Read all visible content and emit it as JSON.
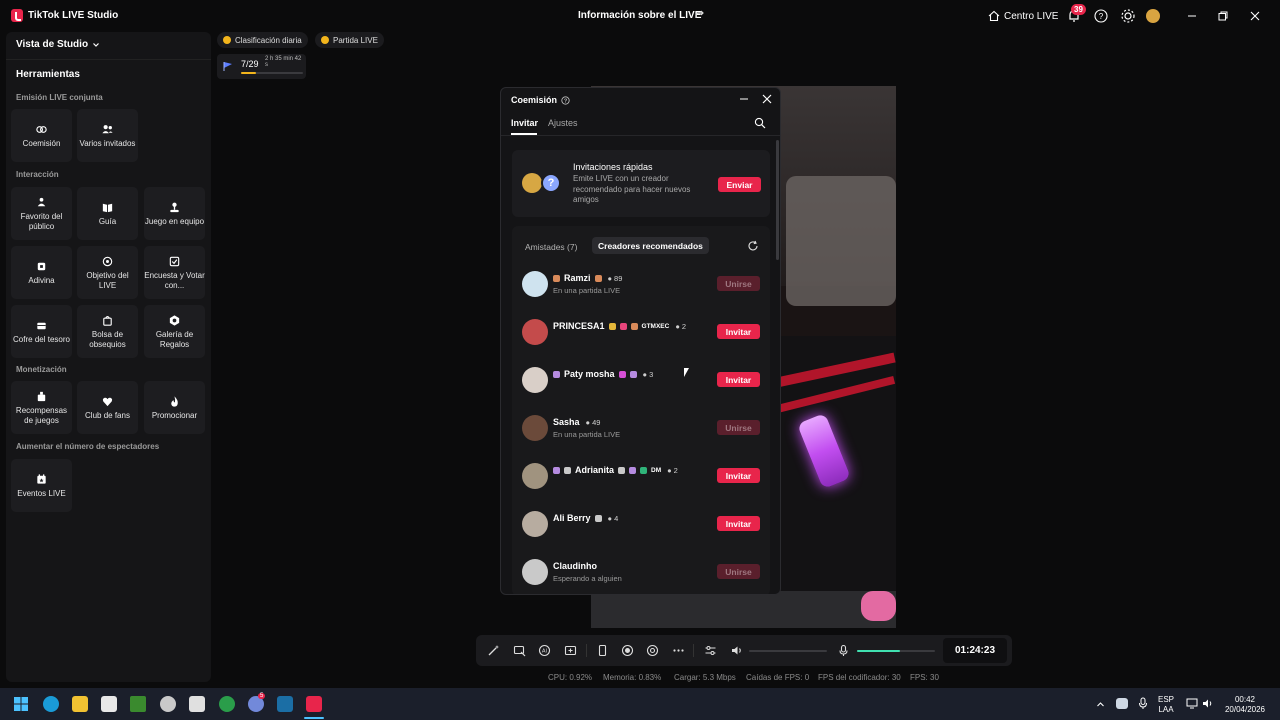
{
  "app": {
    "name": "TikTok LIVE Studio",
    "center_title": "Información sobre el LIVE",
    "centro_label": "Centro LIVE",
    "notifications": "39"
  },
  "sidebar": {
    "view_label": "Vista de Studio",
    "tools_title": "Herramientas",
    "sections": {
      "joint": "Emisión LIVE conjunta",
      "interaction": "Interacción",
      "monetization": "Monetización",
      "viewers": "Aumentar el número de espectadores"
    },
    "tools": {
      "coemision": "Coemisión",
      "varios": "Varios invitados",
      "favorito": "Favorito del público",
      "guia": "Guía",
      "juego_equipo": "Juego en equipo",
      "adivina": "Adivina",
      "objetivo": "Objetivo del LIVE",
      "encuesta": "Encuesta y Votar con...",
      "cofre": "Cofre del tesoro",
      "bolsa": "Bolsa de obsequios",
      "galeria": "Galería de Regalos",
      "recompensas": "Recompensas de juegos",
      "club": "Club de fans",
      "promocionar": "Promocionar",
      "eventos": "Eventos LIVE"
    }
  },
  "chips": {
    "ranking": "Clasificación diaria",
    "match": "Partida LIVE"
  },
  "progress": {
    "count": "7/29",
    "time": "2 h 35 min 42 s",
    "fraction": 0.24
  },
  "modal": {
    "title": "Coemisión",
    "tab_invite": "Invitar",
    "tab_settings": "Ajustes",
    "quick_title": "Invitaciones rápidas",
    "quick_desc": "Emite LIVE con un creador recomendado para hacer nuevos amigos",
    "send_label": "Enviar",
    "list_tab_friends": "Amistades (7)",
    "list_tab_recommended": "Creadores recomendados",
    "rows": [
      {
        "name": "Ramzi",
        "count": "89",
        "sub": "En una partida LIVE",
        "action": "Unirse",
        "enabled": false,
        "color": "#cfe3ef"
      },
      {
        "name": "PRINCESA1",
        "tag": "GTMXEC",
        "count": "2",
        "sub": "",
        "action": "Invitar",
        "enabled": true,
        "color": "#c44b4b"
      },
      {
        "name": "Paty mosha",
        "count": "3",
        "sub": "",
        "action": "Invitar",
        "enabled": true,
        "color": "#d9cfc8"
      },
      {
        "name": "Sasha",
        "count": "49",
        "sub": "En una partida LIVE",
        "action": "Unirse",
        "enabled": false,
        "color": "#6b4a3a"
      },
      {
        "name": "Adrianita",
        "tag": "DM",
        "count": "2",
        "sub": "",
        "action": "Invitar",
        "enabled": true,
        "color": "#a0937f"
      },
      {
        "name": "Ali Berry",
        "count": "4",
        "sub": "",
        "action": "Invitar",
        "enabled": true,
        "color": "#b7aca0"
      },
      {
        "name": "Claudinho",
        "count": "",
        "sub": "Esperando a alguien",
        "action": "Unirse",
        "enabled": false,
        "color": "#c9c9c9"
      }
    ]
  },
  "toolbar": {
    "time": "01:24:23",
    "volume_level": 0.0,
    "mic_level": 0.55
  },
  "stats": {
    "cpu": "CPU:  0.92%",
    "mem": "Memoria:  0.83%",
    "load": "Cargar:  5.3 Mbps",
    "drops": "Caídas de FPS:  0",
    "enc": "FPS del codificador:  30",
    "fps": "FPS:  30"
  },
  "taskbar": {
    "lang1": "ESP",
    "lang2": "LAA",
    "clock": "00:42",
    "date": "20/04/2026",
    "discord_badge": "5"
  }
}
